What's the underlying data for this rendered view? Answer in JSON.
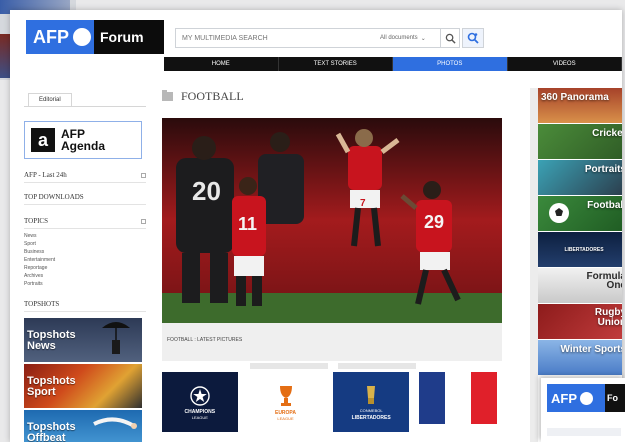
{
  "header": {
    "logo_afp": "AFP",
    "logo_forum": "Forum",
    "search_placeholder": "MY MULTIMEDIA SEARCH",
    "search_scope": "All documents"
  },
  "nav": {
    "tabs": [
      {
        "label": "HOME",
        "active": false
      },
      {
        "label": "TEXT STORIES",
        "active": false
      },
      {
        "label": "PHOTOS",
        "active": true
      },
      {
        "label": "VIDEOS",
        "active": false
      }
    ]
  },
  "sidebar": {
    "tab_label": "Editorial",
    "agenda_line1": "AFP",
    "agenda_line2": "Agenda",
    "afp_last": "AFP - Last 24h",
    "top_downloads": "TOP DOWNLOADS",
    "topics_heading": "TOPICS",
    "topics": [
      "News",
      "Sport",
      "Business",
      "Entertainment",
      "Reportage",
      "Archives",
      "Portraits"
    ],
    "topshots_heading": "TOPSHOTS",
    "tiles": [
      {
        "line1": "Topshots",
        "line2": "News"
      },
      {
        "line1": "Topshots",
        "line2": "Sport"
      },
      {
        "line1": "Topshots",
        "line2": "Offbeat"
      }
    ]
  },
  "content": {
    "section_title": "FOOTBALL",
    "caption": "FOOTBALL : LATEST PICTURES",
    "jersey_numbers": [
      "20",
      "11",
      "29",
      "7"
    ],
    "competitions": [
      {
        "name1": "CHAMPIONS",
        "name2": "LEAGUE"
      },
      {
        "name1": "EUROPA",
        "name2": "LEAGUE"
      },
      {
        "name1": "CONMEBOL",
        "name2": "LIBERTADORES"
      }
    ],
    "flag_colors": [
      "#1f3c8a",
      "#ffffff",
      "#e0202a"
    ]
  },
  "rightcol": {
    "tiles": [
      {
        "label": "360 Panorama"
      },
      {
        "label": "Cricket"
      },
      {
        "label": "Portraits"
      },
      {
        "label": "Football"
      },
      {
        "label": "LIBERTADORES"
      },
      {
        "label1": "Formula",
        "label2": "One"
      },
      {
        "label1": "Rugby",
        "label2": "Union"
      },
      {
        "label": "Winter Sports"
      }
    ]
  },
  "mini": {
    "logo_afp": "AFP",
    "logo_forum": "Fo"
  },
  "colors": {
    "brand_blue": "#2f6fe0",
    "nav_black": "#111111",
    "united_red": "#c8141e"
  }
}
